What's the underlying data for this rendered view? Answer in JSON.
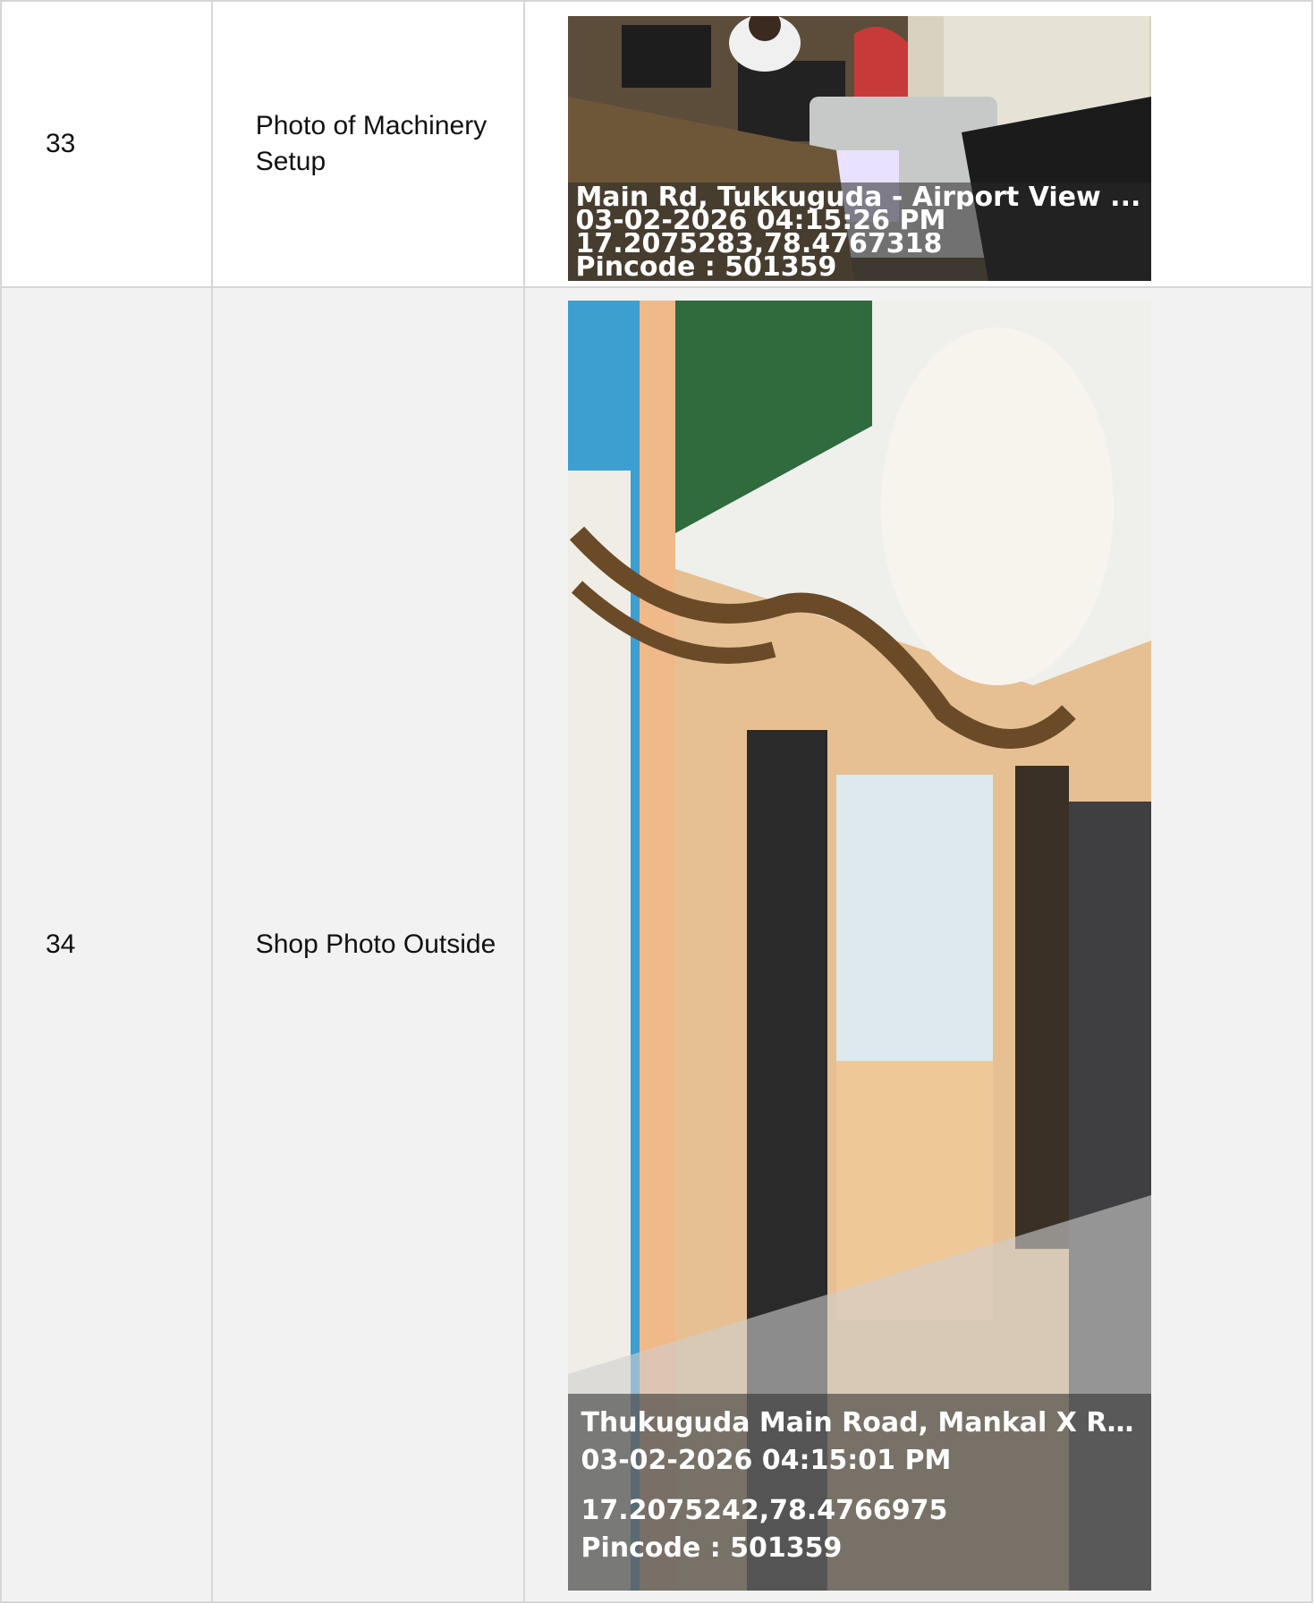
{
  "rows": [
    {
      "number": "33",
      "label": "Photo of Machinery Setup",
      "photo": {
        "address": "Main Rd, Tukkuguda - Airport View ...",
        "datetime": "03-02-2026 04:15:26 PM",
        "coords": "17.2075283,78.4767318",
        "pincode": "Pincode : 501359"
      }
    },
    {
      "number": "34",
      "label": "Shop Photo Outside",
      "photo": {
        "address": "Thukuguda Main Road, Mankal X Road, ...",
        "datetime": "03-02-2026 04:15:01 PM",
        "coords": "17.2075242,78.4766975",
        "pincode": "Pincode : 501359"
      }
    }
  ],
  "colors": {
    "row_alt": "#f2f2f2",
    "border": "#d6d6d6"
  }
}
